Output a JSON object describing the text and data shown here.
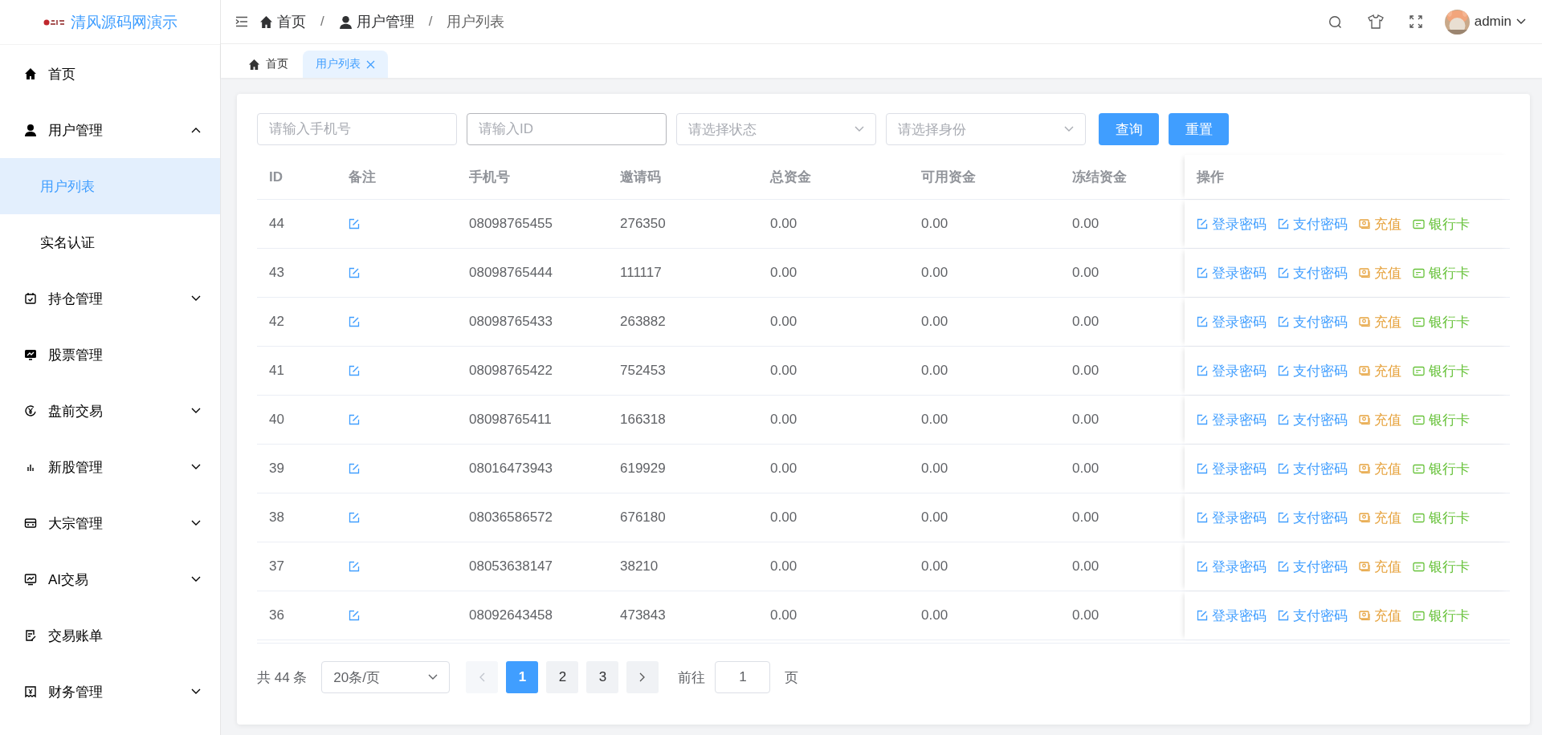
{
  "brand": {
    "title": "清风源码网演示"
  },
  "sidebar": {
    "items": [
      {
        "label": "首页",
        "kind": "link",
        "selected": false
      },
      {
        "label": "用户管理",
        "kind": "group",
        "expanded": true,
        "children": [
          {
            "label": "用户列表",
            "selected": true
          },
          {
            "label": "实名认证",
            "selected": false
          }
        ]
      },
      {
        "label": "持仓管理",
        "kind": "group",
        "expanded": false
      },
      {
        "label": "股票管理",
        "kind": "link",
        "selected": false
      },
      {
        "label": "盘前交易",
        "kind": "group",
        "expanded": false
      },
      {
        "label": "新股管理",
        "kind": "group",
        "expanded": false
      },
      {
        "label": "大宗管理",
        "kind": "group",
        "expanded": false
      },
      {
        "label": "AI交易",
        "kind": "group",
        "expanded": false
      },
      {
        "label": "交易账单",
        "kind": "link",
        "selected": false
      },
      {
        "label": "财务管理",
        "kind": "group",
        "expanded": false
      }
    ]
  },
  "header": {
    "breadcrumbs": [
      "首页",
      "用户管理",
      "用户列表"
    ],
    "separator": "/",
    "user": "admin"
  },
  "tabs": [
    {
      "label": "首页",
      "selected": false,
      "closable": false
    },
    {
      "label": "用户列表",
      "selected": true,
      "closable": true
    }
  ],
  "filters": [
    {
      "kind": "input",
      "placeholder": "请输入手机号",
      "hovered": false
    },
    {
      "kind": "input",
      "placeholder": "请输入ID",
      "hovered": true
    },
    {
      "kind": "select",
      "placeholder": "请选择状态",
      "hovered": false
    },
    {
      "kind": "select",
      "placeholder": "请选择身份",
      "hovered": false
    }
  ],
  "buttons": [
    "查询",
    "重置"
  ],
  "table": {
    "columns": [
      "ID",
      "备注",
      "手机号",
      "邀请码",
      "总资金",
      "可用资金",
      "冻结资金",
      "操作"
    ],
    "rows": [
      {
        "id": "44",
        "phone": "08098765455",
        "invite": "276350",
        "total": "0.00",
        "available": "0.00",
        "frozen": "0.00",
        "actions": [
          {
            "label": "登录密码",
            "kind": "edit",
            "color": "#409eff"
          },
          {
            "label": "支付密码",
            "kind": "edit",
            "color": "#409eff"
          },
          {
            "label": "充值",
            "kind": "wallet",
            "color": "#e6a23c"
          },
          {
            "label": "银行卡",
            "kind": "card",
            "color": "#67c23a"
          }
        ]
      },
      {
        "id": "43",
        "phone": "08098765444",
        "invite": "111117",
        "total": "0.00",
        "available": "0.00",
        "frozen": "0.00",
        "actions": [
          {
            "label": "登录密码",
            "kind": "edit",
            "color": "#409eff"
          },
          {
            "label": "支付密码",
            "kind": "edit",
            "color": "#409eff"
          },
          {
            "label": "充值",
            "kind": "wallet",
            "color": "#e6a23c"
          },
          {
            "label": "银行卡",
            "kind": "card",
            "color": "#67c23a"
          }
        ]
      },
      {
        "id": "42",
        "phone": "08098765433",
        "invite": "263882",
        "total": "0.00",
        "available": "0.00",
        "frozen": "0.00",
        "actions": [
          {
            "label": "登录密码",
            "kind": "edit",
            "color": "#409eff"
          },
          {
            "label": "支付密码",
            "kind": "edit",
            "color": "#409eff"
          },
          {
            "label": "充值",
            "kind": "wallet",
            "color": "#e6a23c"
          },
          {
            "label": "银行卡",
            "kind": "card",
            "color": "#67c23a"
          }
        ]
      },
      {
        "id": "41",
        "phone": "08098765422",
        "invite": "752453",
        "total": "0.00",
        "available": "0.00",
        "frozen": "0.00",
        "actions": [
          {
            "label": "登录密码",
            "kind": "edit",
            "color": "#409eff"
          },
          {
            "label": "支付密码",
            "kind": "edit",
            "color": "#409eff"
          },
          {
            "label": "充值",
            "kind": "wallet",
            "color": "#e6a23c"
          },
          {
            "label": "银行卡",
            "kind": "card",
            "color": "#67c23a"
          }
        ]
      },
      {
        "id": "40",
        "phone": "08098765411",
        "invite": "166318",
        "total": "0.00",
        "available": "0.00",
        "frozen": "0.00",
        "actions": [
          {
            "label": "登录密码",
            "kind": "edit",
            "color": "#409eff"
          },
          {
            "label": "支付密码",
            "kind": "edit",
            "color": "#409eff"
          },
          {
            "label": "充值",
            "kind": "wallet",
            "color": "#e6a23c"
          },
          {
            "label": "银行卡",
            "kind": "card",
            "color": "#67c23a"
          }
        ]
      },
      {
        "id": "39",
        "phone": "08016473943",
        "invite": "619929",
        "total": "0.00",
        "available": "0.00",
        "frozen": "0.00",
        "actions": [
          {
            "label": "登录密码",
            "kind": "edit",
            "color": "#409eff"
          },
          {
            "label": "支付密码",
            "kind": "edit",
            "color": "#409eff"
          },
          {
            "label": "充值",
            "kind": "wallet",
            "color": "#e6a23c"
          },
          {
            "label": "银行卡",
            "kind": "card",
            "color": "#67c23a"
          }
        ]
      },
      {
        "id": "38",
        "phone": "08036586572",
        "invite": "676180",
        "total": "0.00",
        "available": "0.00",
        "frozen": "0.00",
        "actions": [
          {
            "label": "登录密码",
            "kind": "edit",
            "color": "#409eff"
          },
          {
            "label": "支付密码",
            "kind": "edit",
            "color": "#409eff"
          },
          {
            "label": "充值",
            "kind": "wallet",
            "color": "#e6a23c"
          },
          {
            "label": "银行卡",
            "kind": "card",
            "color": "#67c23a"
          }
        ]
      },
      {
        "id": "37",
        "phone": "08053638147",
        "invite": "38210",
        "total": "0.00",
        "available": "0.00",
        "frozen": "0.00",
        "actions": [
          {
            "label": "登录密码",
            "kind": "edit",
            "color": "#409eff"
          },
          {
            "label": "支付密码",
            "kind": "edit",
            "color": "#409eff"
          },
          {
            "label": "充值",
            "kind": "wallet",
            "color": "#e6a23c"
          },
          {
            "label": "银行卡",
            "kind": "card",
            "color": "#67c23a"
          }
        ]
      },
      {
        "id": "36",
        "phone": "08092643458",
        "invite": "473843",
        "total": "0.00",
        "available": "0.00",
        "frozen": "0.00",
        "actions": [
          {
            "label": "登录密码",
            "kind": "edit",
            "color": "#409eff"
          },
          {
            "label": "支付密码",
            "kind": "edit",
            "color": "#409eff"
          },
          {
            "label": "充值",
            "kind": "wallet",
            "color": "#e6a23c"
          },
          {
            "label": "银行卡",
            "kind": "card",
            "color": "#67c23a"
          }
        ]
      }
    ]
  },
  "pagination": {
    "total": "共 44 条",
    "page_size": "20条/页",
    "prev_disabled": true,
    "next_disabled": false,
    "pages": [
      {
        "label": "1",
        "selected": true
      },
      {
        "label": "2",
        "selected": false
      },
      {
        "label": "3",
        "selected": false
      }
    ],
    "jump_label": "前往",
    "jump_value": "1",
    "jump_suffix": "页"
  }
}
